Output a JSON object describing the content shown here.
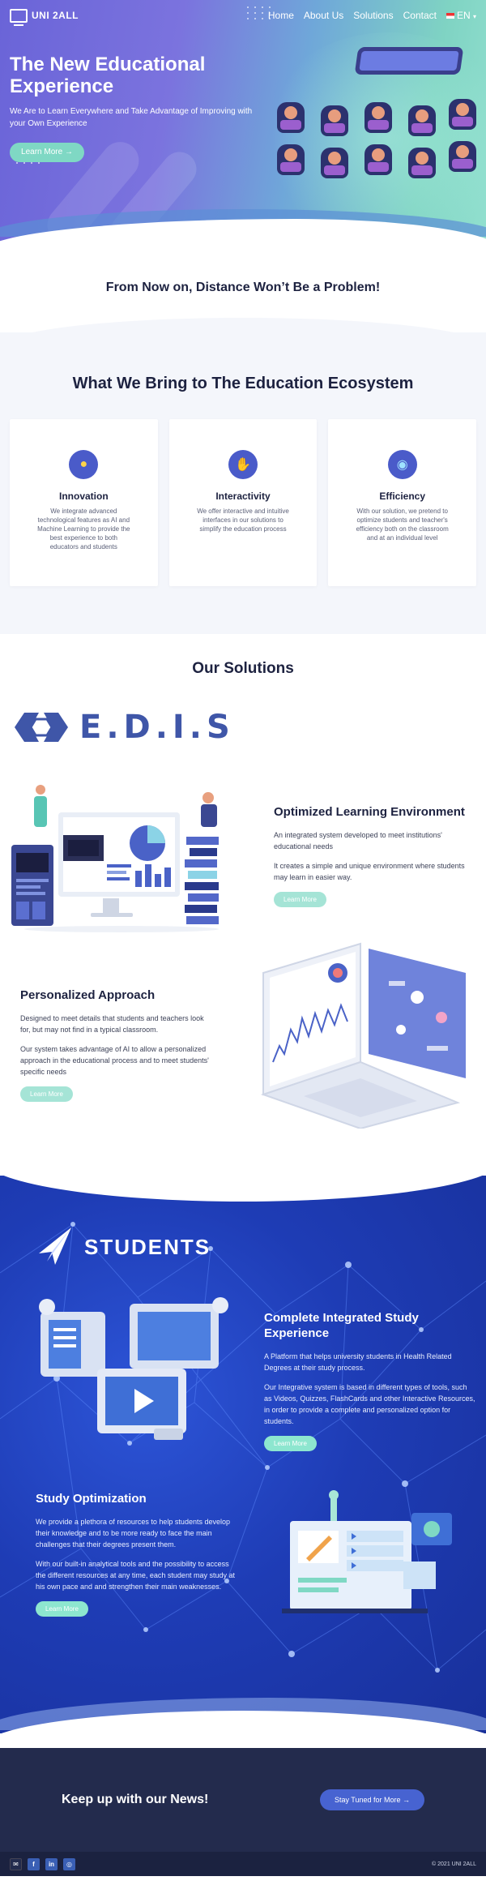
{
  "nav": {
    "brand": "UNI 2ALL",
    "links": [
      "Home",
      "About Us",
      "Solutions",
      "Contact"
    ],
    "language": "EN",
    "language_caret": "▾"
  },
  "hero": {
    "title": "The New Educational Experience",
    "subtitle": "We Are to Learn Everywhere and Take Advantage of Improving with your Own Experience",
    "cta": "Learn More →"
  },
  "tagline": "From Now on, Distance Won’t Be a Problem!",
  "bring": {
    "title": "What We Bring to The Education Ecosystem",
    "cards": [
      {
        "title": "Innovation",
        "text": "We integrate advanced technological features as AI and Machine Learning to provide the best experience to both educators and students",
        "icon": "lightbulb-head-icon"
      },
      {
        "title": "Interactivity",
        "text": "We offer interactive and intuitive interfaces in our solutions to simplify the education process",
        "icon": "touch-hand-icon"
      },
      {
        "title": "Efficiency",
        "text": "With our solution, we pretend to optimize students and teacher's efficiency both on the classroom and at an individual level",
        "icon": "hand-globe-icon"
      }
    ]
  },
  "solutions": {
    "title": "Our Solutions",
    "product": "E.D.I.S",
    "features": [
      {
        "title": "Optimized Learning Environment",
        "paragraphs": [
          "An integrated system developed to meet institutions' educational needs",
          "It creates a simple and unique environment where students may learn in easier way."
        ],
        "button": "Learn More"
      },
      {
        "title": "Personalized Approach",
        "paragraphs": [
          "Designed to meet details that students and teachers look for, but may not find in a typical classroom.",
          "Our system takes advantage of AI to allow a personalized approach in the educational process and to meet students' specific needs"
        ],
        "button": "Learn More"
      }
    ]
  },
  "students": {
    "brand": "STUDENTS",
    "features": [
      {
        "title": "Complete Integrated Study Experience",
        "paragraphs": [
          "A Platform that helps university students in Health Related Degrees at their study process.",
          "Our Integrative system is based in different types of tools, such as Videos, Quizzes, FlashCards and other Interactive Resources, in order to provide a complete and personalized option for students."
        ],
        "button": "Learn More"
      },
      {
        "title": "Study Optimization",
        "paragraphs": [
          "We provide a plethora of resources to help students develop their knowledge and to be more ready to face the main challenges that their degrees present them.",
          "With our built-in analytical tools and the possibility to access the different resources at any time, each student may study at his own pace and and strengthen their main weaknesses."
        ],
        "button": "Learn More"
      }
    ]
  },
  "newsletter": {
    "title": "Keep up with our News!",
    "button": "Stay Tuned for More →"
  },
  "footer": {
    "social": [
      {
        "icon": "mail-icon",
        "glyph": "✉"
      },
      {
        "icon": "facebook-icon",
        "glyph": "f"
      },
      {
        "icon": "linkedin-icon",
        "glyph": "in"
      },
      {
        "icon": "instagram-icon",
        "glyph": "◎"
      }
    ],
    "copyright": "© 2021 UNI 2ALL"
  },
  "colors": {
    "accent": "#7fd8c4",
    "brand_blue": "#4763d1",
    "dark": "#232b4d",
    "students_bg": "#1e3cb5"
  }
}
